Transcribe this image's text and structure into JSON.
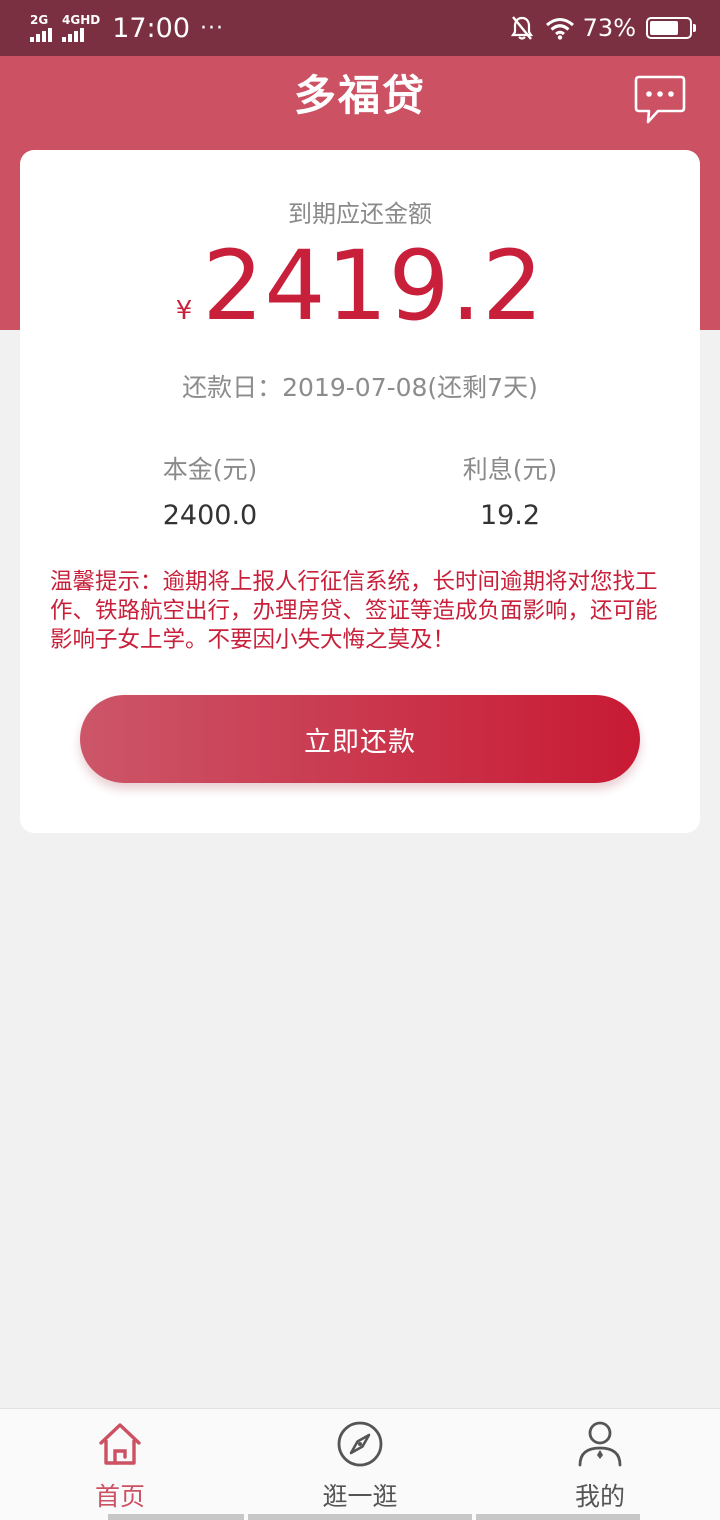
{
  "status_bar": {
    "net1": "2G",
    "net2": "4GHD",
    "time": "17:00",
    "dots": "···",
    "battery_text": "73%",
    "battery_level": 0.73,
    "icons": [
      "signal-icon",
      "mute-bell-icon",
      "wifi-icon",
      "battery-icon"
    ]
  },
  "header": {
    "title": "多福贷",
    "chat_icon": "chat-bubble-icon",
    "color": "#cb5163"
  },
  "card": {
    "due_label": "到期应还金额",
    "currency": "¥",
    "amount": "2419.2",
    "due_date": "还款日：2019-07-08(还剩7天)",
    "principal_label": "本金(元)",
    "principal_value": "2400.0",
    "interest_label": "利息(元)",
    "interest_value": "19.2",
    "warning": "温馨提示：逾期将上报人行征信系统，长时间逾期将对您找工作、铁路航空出行，办理房贷、签证等造成负面影响，还可能影响子女上学。不要因小失大悔之莫及！",
    "pay_button": "立即还款",
    "accent_color": "#c8203a"
  },
  "tabbar": {
    "home_label": "首页",
    "discover_label": "逛一逛",
    "mine_label": "我的",
    "active": "首页",
    "icons": [
      "home-icon",
      "compass-icon",
      "user-icon"
    ]
  }
}
